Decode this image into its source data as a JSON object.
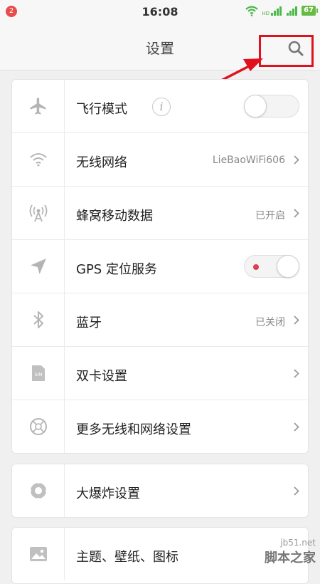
{
  "status_bar": {
    "notification_count": "2",
    "time": "16:08",
    "signal_label": "HD",
    "battery": "67",
    "icons": [
      "wifi-icon",
      "signal-icon",
      "signal-icon",
      "battery-icon"
    ]
  },
  "header": {
    "title": "设置",
    "search_icon": "search-icon"
  },
  "settings": [
    {
      "label": "飞行模式",
      "icon": "airplane-icon",
      "control": "toggle",
      "enabled": false,
      "info": "i"
    },
    {
      "label": "无线网络",
      "icon": "wifi-icon",
      "value": "LieBaoWiFi606",
      "control": "chevron"
    },
    {
      "label": "蜂窝移动数据",
      "icon": "cellular-antenna-icon",
      "value": "已开启",
      "control": "chevron"
    },
    {
      "label": "GPS 定位服务",
      "icon": "location-arrow-icon",
      "control": "toggle",
      "enabled": true
    },
    {
      "label": "蓝牙",
      "icon": "bluetooth-icon",
      "value": "已关闭",
      "control": "chevron"
    },
    {
      "label": "双卡设置",
      "icon": "sim-card-icon",
      "control": "chevron"
    },
    {
      "label": "更多无线和网络设置",
      "icon": "network-globe-icon",
      "control": "chevron"
    }
  ],
  "settings2": [
    {
      "label": "大爆炸设置",
      "icon": "big-bang-icon",
      "control": "chevron"
    },
    {
      "label": "主题、壁纸、图标",
      "icon": "picture-icon",
      "control": "chevron"
    }
  ],
  "watermark": {
    "url": "jb51.net",
    "text": "脚本之家"
  },
  "colors": {
    "background": "#f0f0f0",
    "card": "#ffffff",
    "annotation": "#e0101c",
    "toggle_dot": "#d9434e",
    "battery": "#66bb44"
  }
}
